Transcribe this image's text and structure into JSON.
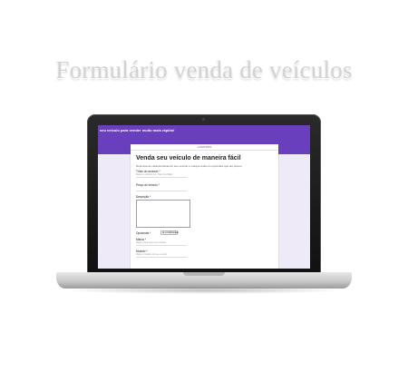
{
  "page": {
    "title": "Formulário venda de veículos"
  },
  "screen": {
    "header_text": "seu veículo para vender muito mais rápido!",
    "account_line": "LOGOTIPO",
    "form": {
      "title": "Venda seu veículo de maneira fácil",
      "description": "Descreva as características do seu veículo e marque todos os opcionais que ele possui.",
      "questions": [
        {
          "label": "Título do anúncio *",
          "placeholder": "Marca e modelo (ex.: Fiat Uno Mille)"
        },
        {
          "label": "Preço do veículo *"
        },
        {
          "label": "Descrição *"
        },
        {
          "label": "Opcionais *",
          "select_value": "Ar-condicionado"
        },
        {
          "label": "Marca *",
          "placeholder": "Digite a marca do seu veículo"
        },
        {
          "label": "Modelo *",
          "placeholder": "Digite o modelo do seu veículo"
        }
      ]
    }
  },
  "colors": {
    "accent": "#6a3fbd",
    "screen_background": "#efeaf8",
    "title_text": "#d2d2d2"
  }
}
